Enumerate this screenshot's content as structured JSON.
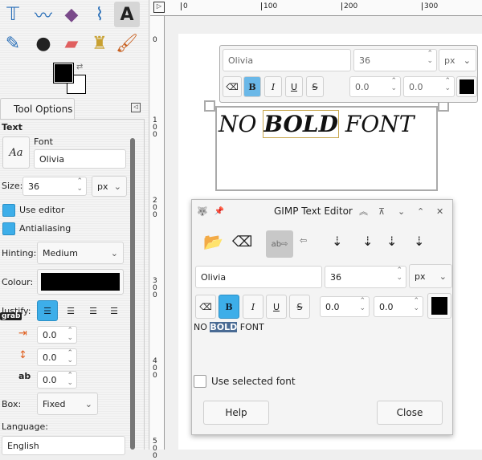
{
  "toolbox": {
    "tools": [
      "text-align-tool",
      "warp-tool",
      "gradient-tool",
      "paths-tool",
      "text-tool",
      "color-picker-tool",
      "airbrush-tool",
      "eraser-tool",
      "clone-tool",
      "paintbrush-tool"
    ]
  },
  "tool_options": {
    "tab_label": "Tool Options",
    "section": "Text",
    "font_label": "Font",
    "font_value": "Olivia",
    "size_label": "Size:",
    "size_value": "36",
    "unit": "px",
    "use_editor": "Use editor",
    "antialiasing": "Antialiasing",
    "hinting_label": "Hinting:",
    "hinting_value": "Medium",
    "colour_label": "Colour:",
    "colour": "#000000",
    "justify_label": "Justify:",
    "grab_tooltip": "grab",
    "indent": "0.0",
    "line_spacing": "0.0",
    "letter_spacing": "0.0",
    "box_label": "Box:",
    "box_value": "Fixed",
    "language_label": "Language:",
    "language_value": "English"
  },
  "rulers": {
    "h": [
      "0",
      "100",
      "200",
      "300"
    ],
    "v": [
      "0",
      "100",
      "200",
      "300",
      "400",
      "500"
    ]
  },
  "canvas": {
    "text_before": "NO ",
    "text_bold": "BOLD",
    "text_after": " FONT",
    "overlay": {
      "font": "Olivia",
      "size": "36",
      "unit": "px",
      "baseline": "0.0",
      "kerning": "0.0",
      "color": "#000000"
    }
  },
  "editor": {
    "title": "GIMP Text Editor",
    "font": "Olivia",
    "size": "36",
    "unit": "px",
    "baseline": "0.0",
    "kerning": "0.0",
    "text_before": "NO ",
    "text_bold": "BOLD",
    "text_after": " FONT",
    "use_selected_font": "Use selected font",
    "help": "Help",
    "close": "Close",
    "bold": "B",
    "italic": "I",
    "underline": "U",
    "strike": "S"
  },
  "colors": {
    "accent": "#3daee9",
    "selection": "#4a6b94"
  }
}
